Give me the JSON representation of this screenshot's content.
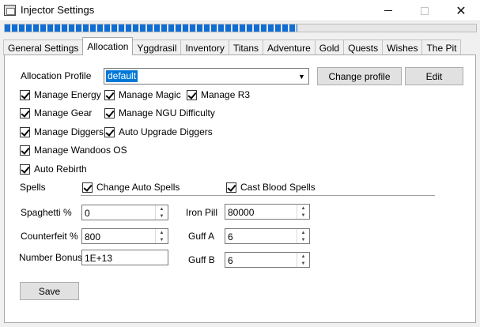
{
  "window": {
    "title": "Injector Settings",
    "minimize_symbol": "",
    "maximize_symbol": "",
    "close_symbol": "✕",
    "progress_fraction": 0.62
  },
  "tabs": [
    {
      "label": "General Settings",
      "active": false
    },
    {
      "label": "Allocation",
      "active": true
    },
    {
      "label": "Yggdrasil",
      "active": false
    },
    {
      "label": "Inventory",
      "active": false
    },
    {
      "label": "Titans",
      "active": false
    },
    {
      "label": "Adventure",
      "active": false
    },
    {
      "label": "Gold",
      "active": false
    },
    {
      "label": "Quests",
      "active": false
    },
    {
      "label": "Wishes",
      "active": false
    },
    {
      "label": "The Pit",
      "active": false
    }
  ],
  "allocation": {
    "profile_label": "Allocation Profile",
    "profile_value": "default",
    "change_profile_label": "Change profile",
    "edit_label": "Edit",
    "checkboxes": {
      "manage_energy": {
        "label": "Manage Energy",
        "checked": true
      },
      "manage_magic": {
        "label": "Manage Magic",
        "checked": true
      },
      "manage_r3": {
        "label": "Manage R3",
        "checked": true
      },
      "manage_gear": {
        "label": "Manage Gear",
        "checked": true
      },
      "manage_ngu_difficulty": {
        "label": "Manage NGU Difficulty",
        "checked": true
      },
      "manage_diggers": {
        "label": "Manage Diggers",
        "checked": true
      },
      "auto_upgrade_diggers": {
        "label": "Auto Upgrade Diggers",
        "checked": true
      },
      "manage_wandoos_os": {
        "label": "Manage Wandoos OS",
        "checked": true
      },
      "auto_rebirth": {
        "label": "Auto Rebirth",
        "checked": true
      },
      "change_auto_spells": {
        "label": "Change Auto Spells",
        "checked": true
      },
      "cast_blood_spells": {
        "label": "Cast Blood Spells",
        "checked": true
      }
    },
    "spells_label": "Spells",
    "fields": {
      "spaghetti": {
        "label": "Spaghetti %",
        "value": "0"
      },
      "counterfeit": {
        "label": "Counterfeit %",
        "value": "800"
      },
      "number_bonus": {
        "label": "Number Bonus",
        "value": "1E+13"
      },
      "iron_pill": {
        "label": "Iron Pill",
        "value": "80000"
      },
      "guff_a": {
        "label": "Guff A",
        "value": "6"
      },
      "guff_b": {
        "label": "Guff B",
        "value": "6"
      }
    },
    "save_label": "Save"
  }
}
